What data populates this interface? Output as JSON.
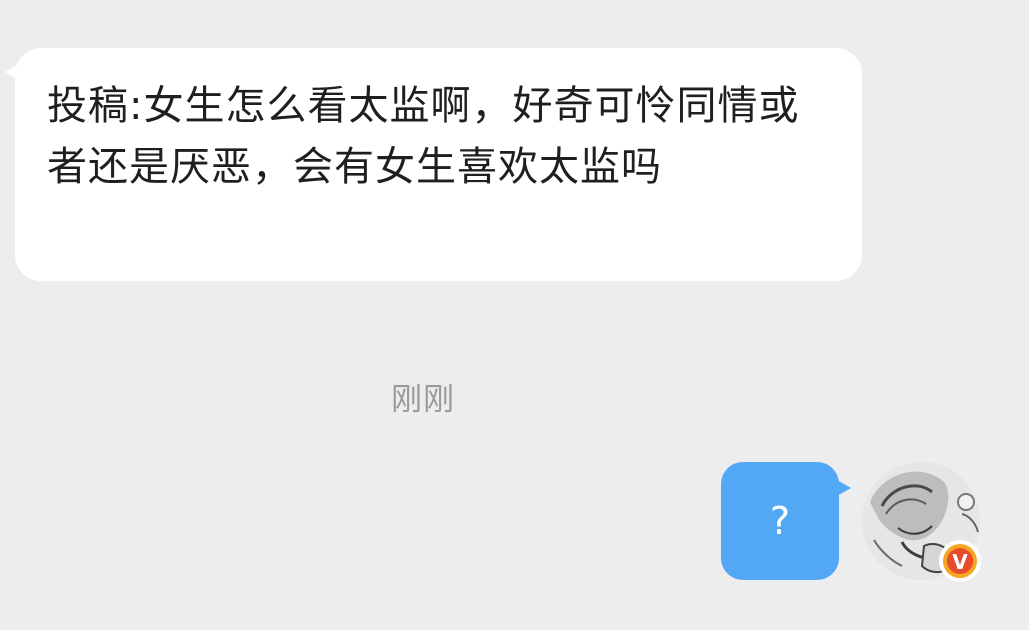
{
  "conversation": {
    "incoming_message": {
      "text": "投稿:女生怎么看太监啊，好奇可怜同情或者还是厌恶，会有女生喜欢太监吗"
    },
    "timestamp": "刚刚",
    "outgoing_message": {
      "text": "?"
    },
    "avatar": {
      "badge_letter": "V"
    }
  },
  "colors": {
    "background": "#ededed",
    "incoming_bubble": "#ffffff",
    "outgoing_bubble": "#53a8f6",
    "timestamp_text": "#9a9a9a",
    "verified_badge": "#e84b2a"
  }
}
